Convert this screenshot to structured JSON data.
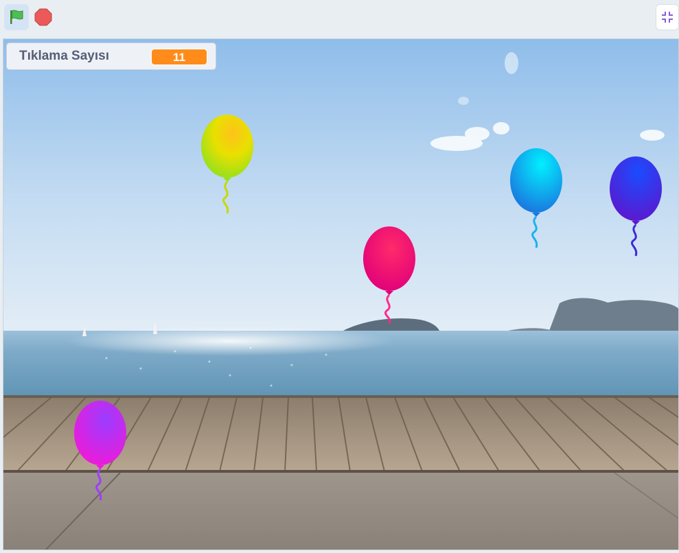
{
  "controls": {
    "green_flag": "green-flag-icon",
    "stop": "stop-icon",
    "fullscreen": "fullscreen-exit-icon"
  },
  "monitor": {
    "label": "Tıklama Sayısı",
    "value": "11",
    "value_color": "#ff8c1a"
  },
  "sprites": [
    {
      "name": "balloon",
      "color": "yellow"
    },
    {
      "name": "balloon",
      "color": "magenta"
    },
    {
      "name": "balloon",
      "color": "cyan"
    },
    {
      "name": "balloon",
      "color": "blue"
    },
    {
      "name": "balloon",
      "color": "purple"
    }
  ],
  "colors": {
    "sky_top": "#9ec5ec",
    "sea": "#6a9fc0",
    "boardwalk": "#a89680",
    "accent": "#ff8c1a"
  }
}
